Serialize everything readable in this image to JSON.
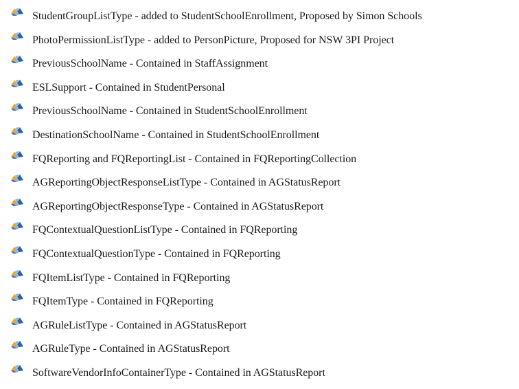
{
  "icon": {
    "name": "sif-bullet-icon",
    "colors": {
      "orange": "#e8a33a",
      "blue": "#2a61a8",
      "light": "#8fb7de"
    }
  },
  "items": [
    "StudentGroupListType - added to StudentSchoolEnrollment, Proposed by Simon Schools",
    "PhotoPermissionListType - added to PersonPicture, Proposed for NSW 3PI Project",
    "PreviousSchoolName - Contained in StaffAssignment",
    "ESLSupport - Contained in StudentPersonal",
    "PreviousSchoolName - Contained in StudentSchoolEnrollment",
    "DestinationSchoolName - Contained in StudentSchoolEnrollment",
    "FQReporting and FQReportingList - Contained in FQReportingCollection",
    "AGReportingObjectResponseListType - Contained in AGStatusReport",
    "AGReportingObjectResponseType - Contained in AGStatusReport",
    "FQContextualQuestionListType - Contained in FQReporting",
    "FQContextualQuestionType - Contained in FQReporting",
    "FQItemListType - Contained in FQReporting",
    "FQItemType - Contained in FQReporting",
    "AGRuleListType - Contained in AGStatusReport",
    "AGRuleType - Contained in AGStatusReport",
    "SoftwareVendorInfoContainerType - Contained in AGStatusReport"
  ]
}
